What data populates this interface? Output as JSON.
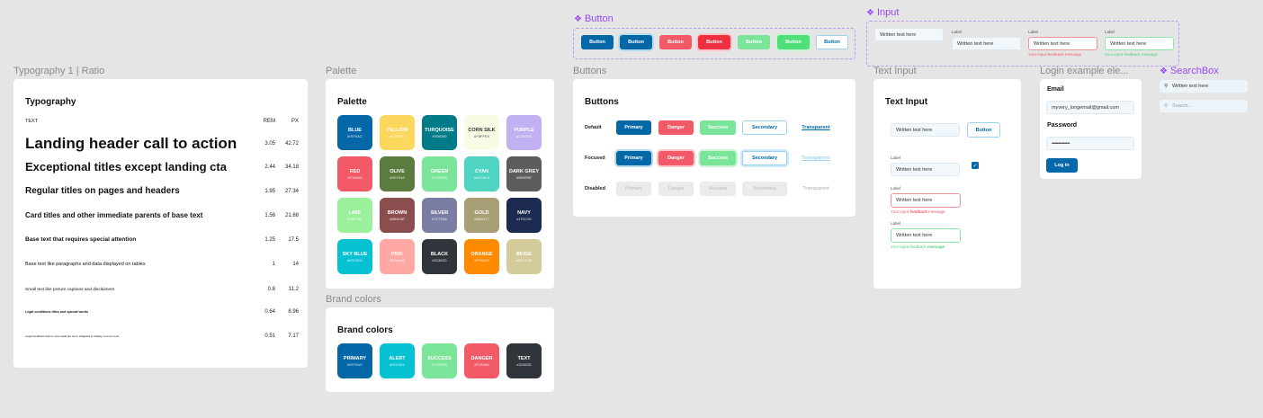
{
  "labels": {
    "typography_frame": "Typography 1 | Ratio",
    "palette_frame": "Palette",
    "brand_frame": "Brand colors",
    "buttons_frame": "Buttons",
    "text_input_frame": "Text Input",
    "login_frame": "Login example ele...",
    "button_component": "Button",
    "input_component": "Input",
    "searchbox_component": "SearchBox"
  },
  "typography": {
    "title": "Typography",
    "col_text": "TEXT",
    "col_rem": "REM",
    "col_px": "PX",
    "rows": [
      {
        "text": "Landing header call to action",
        "rem": "3.05",
        "px": "42.72"
      },
      {
        "text": "Exceptional titles except landing cta",
        "rem": "2.44",
        "px": "34.18"
      },
      {
        "text": "Regular titles on pages and headers",
        "rem": "1.95",
        "px": "27.34"
      },
      {
        "text": "Card titles and other immediate parents of base text",
        "rem": "1.56",
        "px": "21.88"
      },
      {
        "text": "Base text that requires special attention",
        "rem": "1.25",
        "px": "17.5"
      },
      {
        "text": "Base text like paragraphs and data displayed on tables",
        "rem": "1",
        "px": "14"
      },
      {
        "text": "Small text like picture captions and disclaimers",
        "rem": "0.8",
        "px": "11.2"
      },
      {
        "text": "Legal conditions titles and special words",
        "rem": "0.64",
        "px": "8.96"
      },
      {
        "text": "Legal conditions that no-one reads but we're obligated to display no-one's ever",
        "rem": "0.51",
        "px": "7.17"
      }
    ]
  },
  "palette": {
    "title": "Palette",
    "swatches": [
      {
        "name": "BLUE",
        "hex": "#0070AC",
        "color": "#0468a8",
        "text": "#ffffff"
      },
      {
        "name": "YELLOW",
        "hex": "#FFE05D",
        "color": "#fbd85d",
        "text": "#ffffff"
      },
      {
        "name": "TURQUOISE",
        "hex": "#00808D",
        "color": "#027b89",
        "text": "#ffffff"
      },
      {
        "name": "CORN SILK",
        "hex": "#F8FFE9",
        "color": "#f7fde4",
        "text": "#333333"
      },
      {
        "name": "PURPLE",
        "hex": "#C3B3FA",
        "color": "#c2b1f2",
        "text": "#ffffff"
      },
      {
        "name": "RED",
        "hex": "#F15A66",
        "color": "#f15a66",
        "text": "#ffffff"
      },
      {
        "name": "OLIVE",
        "hex": "#5D7E40",
        "color": "#5c7b3f",
        "text": "#ffffff"
      },
      {
        "name": "GREEN",
        "hex": "#7CE898",
        "color": "#7ae499",
        "text": "#ffffff"
      },
      {
        "name": "CYAN",
        "hex": "#4ED8C4",
        "color": "#4ed4c1",
        "text": "#ffffff"
      },
      {
        "name": "DARK GREY",
        "hex": "#5E5E5E",
        "color": "#5d5d5d",
        "text": "#ffffff"
      },
      {
        "name": "LIME",
        "hex": "#9BF19E",
        "color": "#9af09b",
        "text": "#ffffff"
      },
      {
        "name": "BROWN",
        "hex": "#8B4E4E",
        "color": "#8b4e4f",
        "text": "#ffffff"
      },
      {
        "name": "SILVER",
        "hex": "#7C7FA6",
        "color": "#7b7ea4",
        "text": "#ffffff"
      },
      {
        "name": "GOLD",
        "hex": "#A8A077",
        "color": "#a89f76",
        "text": "#ffffff"
      },
      {
        "name": "NAVY",
        "hex": "#1F2C50",
        "color": "#1e2b50",
        "text": "#ffffff"
      },
      {
        "name": "SKY BLUE",
        "hex": "#00C0D1",
        "color": "#05c1d2",
        "text": "#ffffff"
      },
      {
        "name": "PINK",
        "hex": "#FFA8A8",
        "color": "#ffa8a4",
        "text": "#ffffff"
      },
      {
        "name": "BLACK",
        "hex": "#31363D",
        "color": "#30353b",
        "text": "#ffffff"
      },
      {
        "name": "ORANGE",
        "hex": "#FF8A00",
        "color": "#fe8a00",
        "text": "#ffffff"
      },
      {
        "name": "BEIGE",
        "hex": "#D5CC9E",
        "color": "#d4cb9a",
        "text": "#ffffff"
      }
    ]
  },
  "brand": {
    "title": "Brand colors",
    "swatches": [
      {
        "name": "PRIMARY",
        "hex": "#0070AC",
        "color": "#0468a8",
        "text": "#ffffff"
      },
      {
        "name": "ALERT",
        "hex": "#00C0D1",
        "color": "#05c1d2",
        "text": "#ffffff"
      },
      {
        "name": "SUCCESS",
        "hex": "#7CE898",
        "color": "#7ae499",
        "text": "#ffffff"
      },
      {
        "name": "DANGER",
        "hex": "#F15A66",
        "color": "#f15a66",
        "text": "#ffffff"
      },
      {
        "name": "TEXT",
        "hex": "#31363D",
        "color": "#30353b",
        "text": "#ffffff"
      }
    ]
  },
  "button_component": {
    "label": "Button",
    "colors": [
      "#0468a8",
      "#0468a8",
      "#f15a66",
      "#f0303f",
      "#7ae499",
      "#50e07a",
      "#ffffff"
    ]
  },
  "buttons": {
    "title": "Buttons",
    "row_default": "Default",
    "row_focused": "Focused",
    "row_disabled": "Disabled",
    "primary": "Primary",
    "danger": "Danger",
    "success": "Success",
    "secondary": "Secondary",
    "transparent": "Transparent"
  },
  "input_component": {
    "label": "Label",
    "value": "Written text here",
    "red_msg": "Your input feedback message",
    "green_msg": "Your input feedback message"
  },
  "text_input": {
    "title": "Text Input",
    "value": "Written text here",
    "button": "Button",
    "label": "Label",
    "red_msg_pre": "Your input ",
    "red_msg_bold": "feedback",
    "red_msg_post": " message",
    "green_msg_pre": "Your input feedback ",
    "green_msg_bold": "message"
  },
  "login": {
    "email_label": "Email",
    "email_value": "myvery_longemail@gmail.com",
    "password_label": "Password",
    "password_value": "••••••••••••••",
    "login_button": "Log in"
  },
  "searchbox": {
    "value": "Written text here",
    "placeholder": "Search..."
  }
}
